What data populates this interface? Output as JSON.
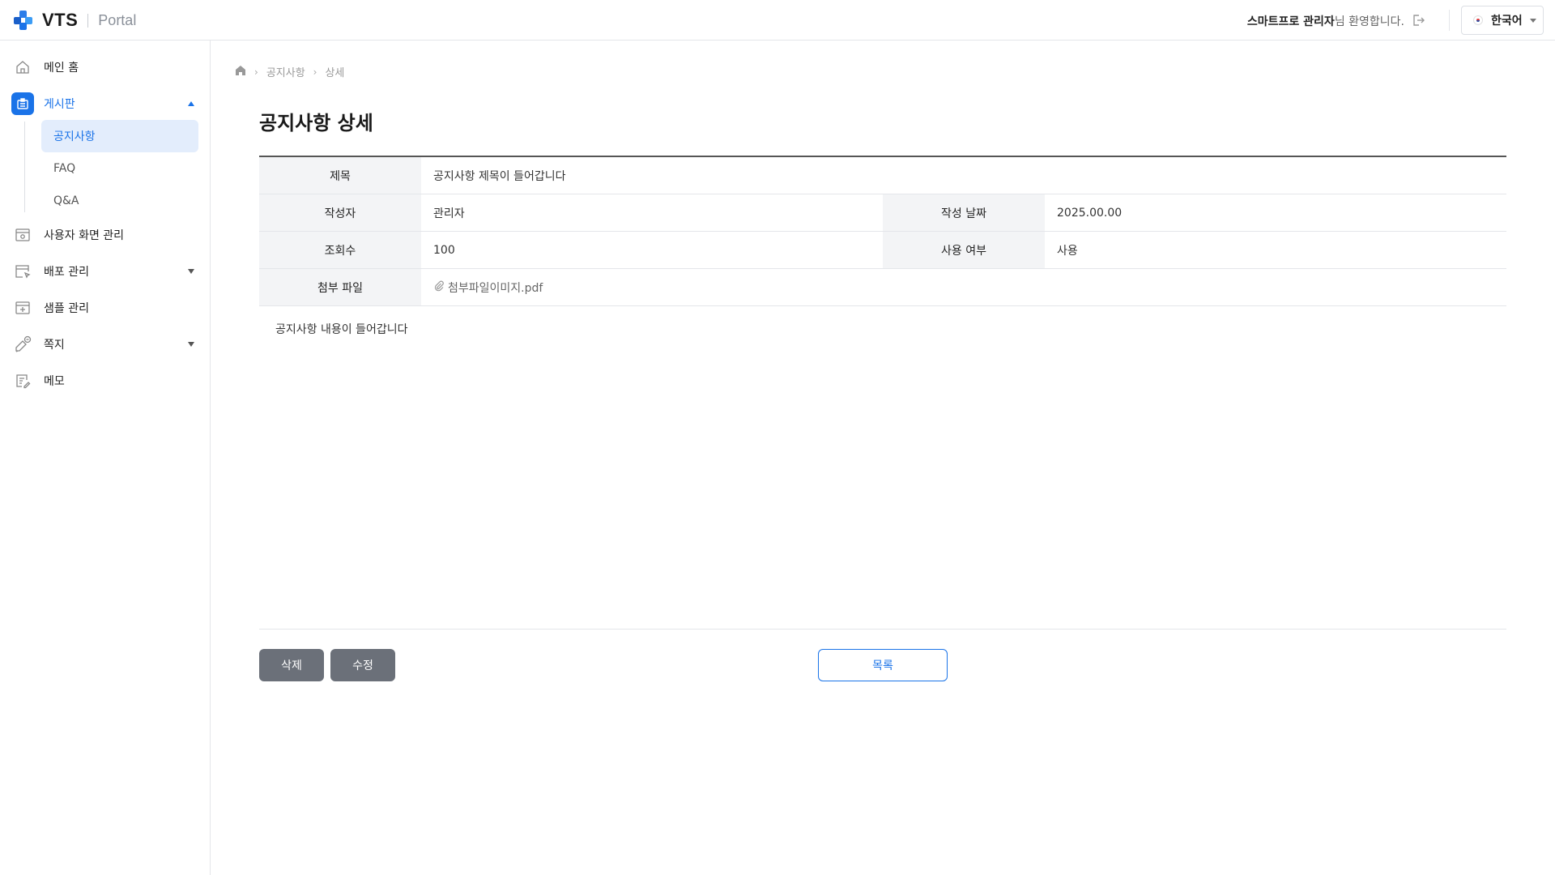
{
  "header": {
    "logo_text": "VTS",
    "logo_sub": "Portal",
    "welcome_user": "스마트프로 관리자",
    "welcome_suffix": "님 환영합니다.",
    "language": "한국어"
  },
  "sidebar": {
    "items": [
      {
        "label": "메인 홈",
        "icon": "home-icon"
      },
      {
        "label": "게시판",
        "icon": "board-icon",
        "expanded": true,
        "children": [
          {
            "label": "공지사항",
            "active": true
          },
          {
            "label": "FAQ"
          },
          {
            "label": "Q&A"
          }
        ]
      },
      {
        "label": "사용자 화면 관리",
        "icon": "screen-settings-icon"
      },
      {
        "label": "배포 관리",
        "icon": "deploy-icon",
        "expandable": true
      },
      {
        "label": "샘플 관리",
        "icon": "sample-icon"
      },
      {
        "label": "쪽지",
        "icon": "message-icon",
        "expandable": true
      },
      {
        "label": "메모",
        "icon": "memo-icon"
      }
    ]
  },
  "breadcrumb": [
    "공지사항",
    "상세"
  ],
  "page_title": "공지사항 상세",
  "detail": {
    "title_label": "제목",
    "title_value": "공지사항 제목이 들어갑니다",
    "author_label": "작성자",
    "author_value": "관리자",
    "date_label": "작성 날짜",
    "date_value": "2025.00.00",
    "views_label": "조회수",
    "views_value": "100",
    "use_label": "사용 여부",
    "use_value": "사용",
    "attach_label": "첨부 파일",
    "attach_value": "첨부파일이미지.pdf"
  },
  "content": "공지사항 내용이 들어갑니다",
  "buttons": {
    "delete": "삭제",
    "edit": "수정",
    "list": "목록"
  },
  "colors": {
    "accent": "#1a73e8",
    "gray_button": "#6b7079",
    "table_header_bg": "#f3f4f6"
  }
}
